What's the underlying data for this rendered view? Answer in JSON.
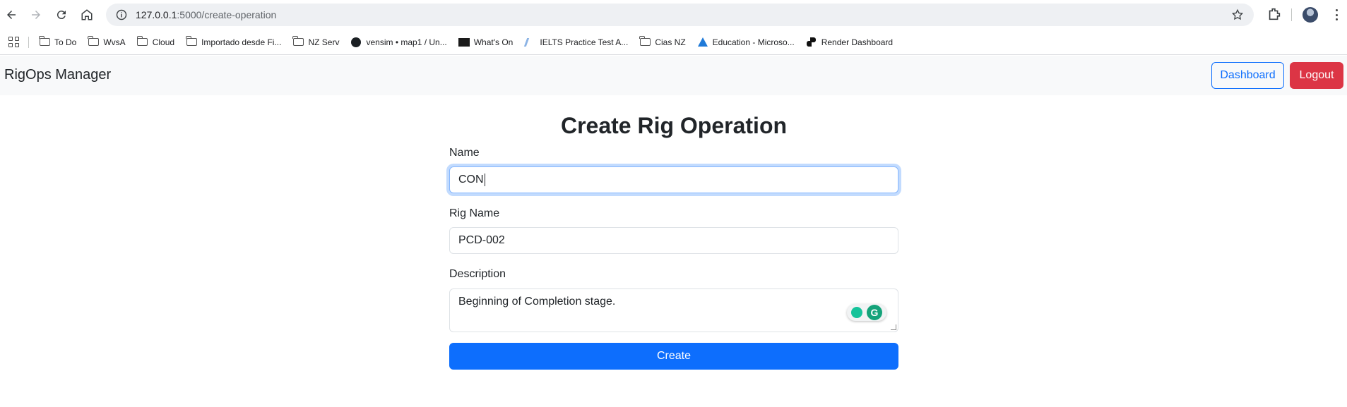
{
  "browser": {
    "url_host": "127.0.0.1",
    "url_path": ":5000/create-operation",
    "bookmarks": [
      {
        "label": "To Do",
        "icon": "folder-icon"
      },
      {
        "label": "WvsA",
        "icon": "folder-icon"
      },
      {
        "label": "Cloud",
        "icon": "folder-icon"
      },
      {
        "label": "Importado desde Fi...",
        "icon": "folder-icon"
      },
      {
        "label": "NZ Serv",
        "icon": "folder-icon"
      },
      {
        "label": "vensim • map1 / Un...",
        "icon": "github-icon"
      },
      {
        "label": "What's On",
        "icon": "whats-on-icon"
      },
      {
        "label": "IELTS Practice Test A...",
        "icon": "ielts-icon"
      },
      {
        "label": "Cias NZ",
        "icon": "folder-icon"
      },
      {
        "label": "Education - Microso...",
        "icon": "azure-icon"
      },
      {
        "label": "Render Dashboard",
        "icon": "render-icon"
      }
    ]
  },
  "navbar": {
    "brand": "RigOps Manager",
    "dashboard_label": "Dashboard",
    "logout_label": "Logout"
  },
  "form": {
    "title": "Create Rig Operation",
    "name_label": "Name",
    "name_value": "CON",
    "rig_name_label": "Rig Name",
    "rig_name_value": "PCD-002",
    "description_label": "Description",
    "description_value": "Beginning of Completion stage.",
    "submit_label": "Create"
  },
  "colors": {
    "primary": "#0d6efd",
    "danger": "#dc3545",
    "navbar_bg": "#f8f9fa"
  }
}
